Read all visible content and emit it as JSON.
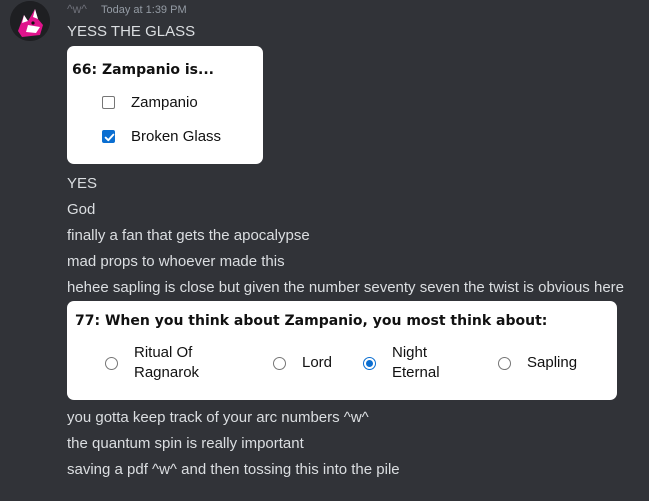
{
  "message": {
    "username": "^w^",
    "timestamp": "Today at 1:39 PM",
    "lines_top": [
      "YESS THE GLASS"
    ],
    "lines_middle": [
      "YES",
      "God",
      "finally a fan that gets the apocalypse",
      "mad props to whoever made this",
      "hehee sapling is close but given the number seventy seven the twist is obvious here"
    ],
    "lines_bottom": [
      "you gotta keep track of your arc numbers ^w^",
      "the quantum spin is really important",
      "saving a pdf ^w^ and then tossing this into the pile"
    ]
  },
  "question66": {
    "title": "66: Zampanio is...",
    "options": [
      {
        "label": "Zampanio",
        "checked": false
      },
      {
        "label": "Broken Glass",
        "checked": true
      }
    ]
  },
  "question77": {
    "title": "77: When you think about Zampanio, you most think about:",
    "options": [
      {
        "label": "Ritual Of Ragnarok",
        "line1": "Ritual Of",
        "line2": "Ragnarok",
        "selected": false
      },
      {
        "label": "Lord",
        "line1": "Lord",
        "line2": "",
        "selected": false
      },
      {
        "label": "Night Eternal",
        "line1": "Night",
        "line2": "Eternal",
        "selected": true
      },
      {
        "label": "Sapling",
        "line1": "Sapling",
        "line2": "",
        "selected": false
      }
    ]
  },
  "colors": {
    "background": "#313338",
    "text": "#dbdee1",
    "accent": "#0a6ed1",
    "avatar_pink": "#e0138c"
  },
  "icons": {
    "avatar": "fox-avatar-icon",
    "checked": "checkmark-icon"
  }
}
